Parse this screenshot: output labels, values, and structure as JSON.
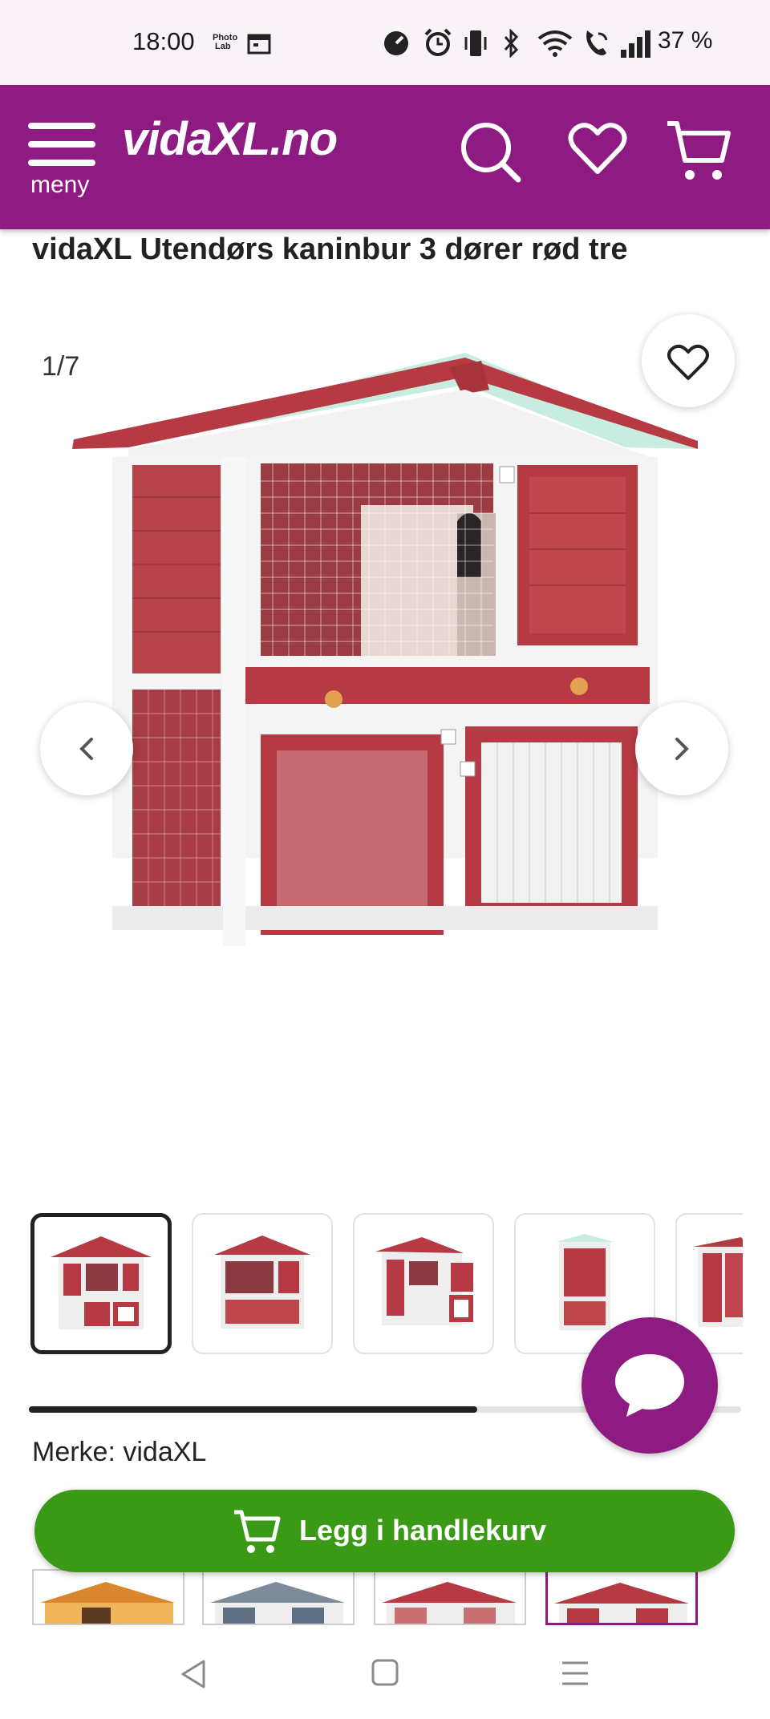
{
  "status_bar": {
    "time": "18:00",
    "photo_lab_line1": "Photo",
    "photo_lab_line2": "Lab",
    "battery": "37 %"
  },
  "header": {
    "menu_label": "meny",
    "logo_text": "vidaXL.no"
  },
  "product": {
    "title": "vidaXL Utendørs kaninbur 3 dører rød tre",
    "image_counter": "1/7",
    "brand": "Merke: vidaXL",
    "add_to_cart": "Legg i handlekurv"
  },
  "gallery": {
    "scroll_progress": 0.63,
    "thumbnails": [
      "front-view",
      "front-view-2",
      "open-doors",
      "side-view",
      "angle-view"
    ]
  },
  "colors": {
    "brand_purple": "#8e1b82",
    "cart_green": "#3a9a16",
    "hutch_red": "#b03a40"
  },
  "icons": [
    "hamburger-icon",
    "search-icon",
    "heart-icon",
    "cart-icon",
    "chat-icon",
    "chevron-left-icon",
    "chevron-right-icon",
    "back-nav-icon",
    "home-nav-icon",
    "recents-nav-icon"
  ]
}
